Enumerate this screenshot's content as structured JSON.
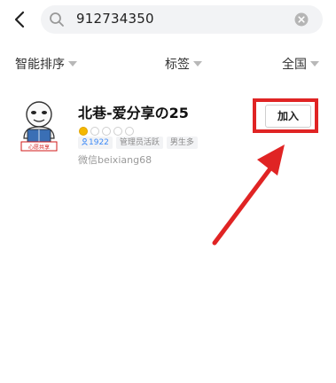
{
  "search": {
    "query": "912734350"
  },
  "filters": [
    {
      "label": "智能排序"
    },
    {
      "label": "标签"
    },
    {
      "label": "全国"
    }
  ],
  "result": {
    "name": "北巷-爱分享の25",
    "avatar_caption": "心愿共享",
    "level": {
      "filled": 1,
      "total": 5
    },
    "tags": [
      {
        "label": "1922",
        "kind": "members"
      },
      {
        "label": "管理员活跃",
        "kind": "plain"
      },
      {
        "label": "男生多",
        "kind": "plain"
      }
    ],
    "wechat": "微信beixiang68",
    "join_label": "加入"
  },
  "colors": {
    "highlight": "#e02424",
    "member_blue": "#3d8af7",
    "coin_gold": "#f5b800"
  }
}
